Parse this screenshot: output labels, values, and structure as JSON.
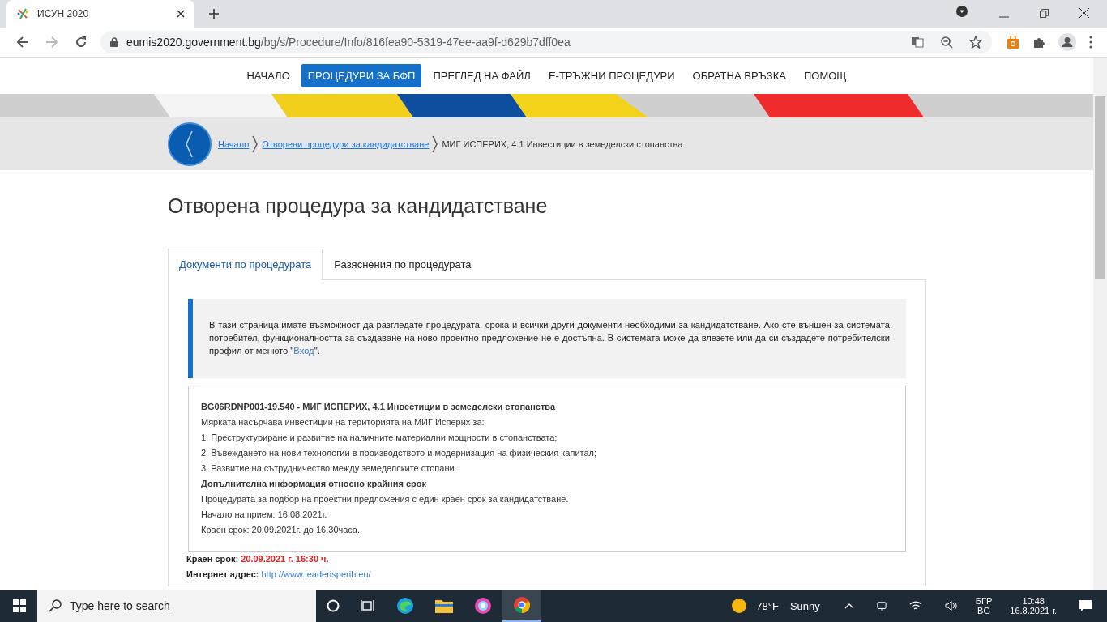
{
  "browser": {
    "tab_title": "ИСУН 2020",
    "url_host": "eumis2020.government.bg",
    "url_path": "/bg/s/Procedure/Info/816fea90-5319-47ee-aa9f-d629b7dff0ea"
  },
  "nav": [
    {
      "label": "НАЧАЛО",
      "selected": false
    },
    {
      "label": "ПРОЦЕДУРИ ЗА БФП",
      "selected": true
    },
    {
      "label": "ПРЕГЛЕД НА ФАЙЛ",
      "selected": false
    },
    {
      "label": "Е-ТРЪЖНИ ПРОЦЕДУРИ",
      "selected": false
    },
    {
      "label": "ОБРАТНА ВРЪЗКА",
      "selected": false
    },
    {
      "label": "ПОМОЩ",
      "selected": false
    }
  ],
  "breadcrumb": [
    {
      "label": "Начало",
      "kind": "link"
    },
    {
      "label": "Отворени процедури за кандидатстване",
      "kind": "link"
    },
    {
      "label": "МИГ ИСПЕРИХ, 4.1 Инвестиции в земеделски стопанства",
      "kind": "current"
    }
  ],
  "page_title": "Отворена процедура за кандидатстване",
  "tabs": [
    {
      "label": "Документи по процедурата",
      "selected": true
    },
    {
      "label": "Разяснения по процедурата",
      "selected": false
    }
  ],
  "notice": {
    "text_before": "В тази страница имате възможност да разгледате процедурата, срока и всички други документи необходими за кандидатстване. Ако сте външен за системата потребител, функционалността за създаване на ново проектно предложение не е достъпна. В системата може да влезете или да си създадете потребителски профил от менюто \"",
    "link": "Вход",
    "text_after": "\"."
  },
  "procedure": {
    "lines": [
      {
        "kind": "heading",
        "text": "BG06RDNP001-19.540 - МИГ ИСПЕРИХ, 4.1 Инвестиции в земеделски стопанства"
      },
      {
        "kind": "plain",
        "text": "Мярката насърчава инвестиции на територията на МИГ Исперих за:"
      },
      {
        "kind": "plain",
        "text": "1. Преструктуриране и развитие на наличните материални мощности в стопанствата;"
      },
      {
        "kind": "plain",
        "text": "2. Въвеждането на нови технологии в производството и модернизация на физическия капитал;"
      },
      {
        "kind": "plain",
        "text": "3. Развитие на сътрудничество между земеделските стопани."
      },
      {
        "kind": "heading",
        "text": "Допълнителна информация относно крайния срок"
      },
      {
        "kind": "plain",
        "text": "Процедурата за подбор на проектни предложения с един краен срок за кандидатстване."
      },
      {
        "kind": "plain",
        "text": "Начало на прием: 16.08.2021г."
      },
      {
        "kind": "plain",
        "text": "Краен срок: 20.09.2021г. до 16.30часа."
      }
    ]
  },
  "deadline": {
    "label": "Краен срок:",
    "value": "20.09.2021 г. 16:30 ч."
  },
  "website": {
    "label": "Интернет адрес:",
    "link": "http://www.leaderisperih.eu/"
  },
  "taskbar": {
    "search_placeholder": "Type here to search",
    "temperature": "78°F",
    "weather": "Sunny",
    "language": "БГР",
    "layout": "BG",
    "time": "10:48",
    "date": "16.8.2021 г."
  }
}
